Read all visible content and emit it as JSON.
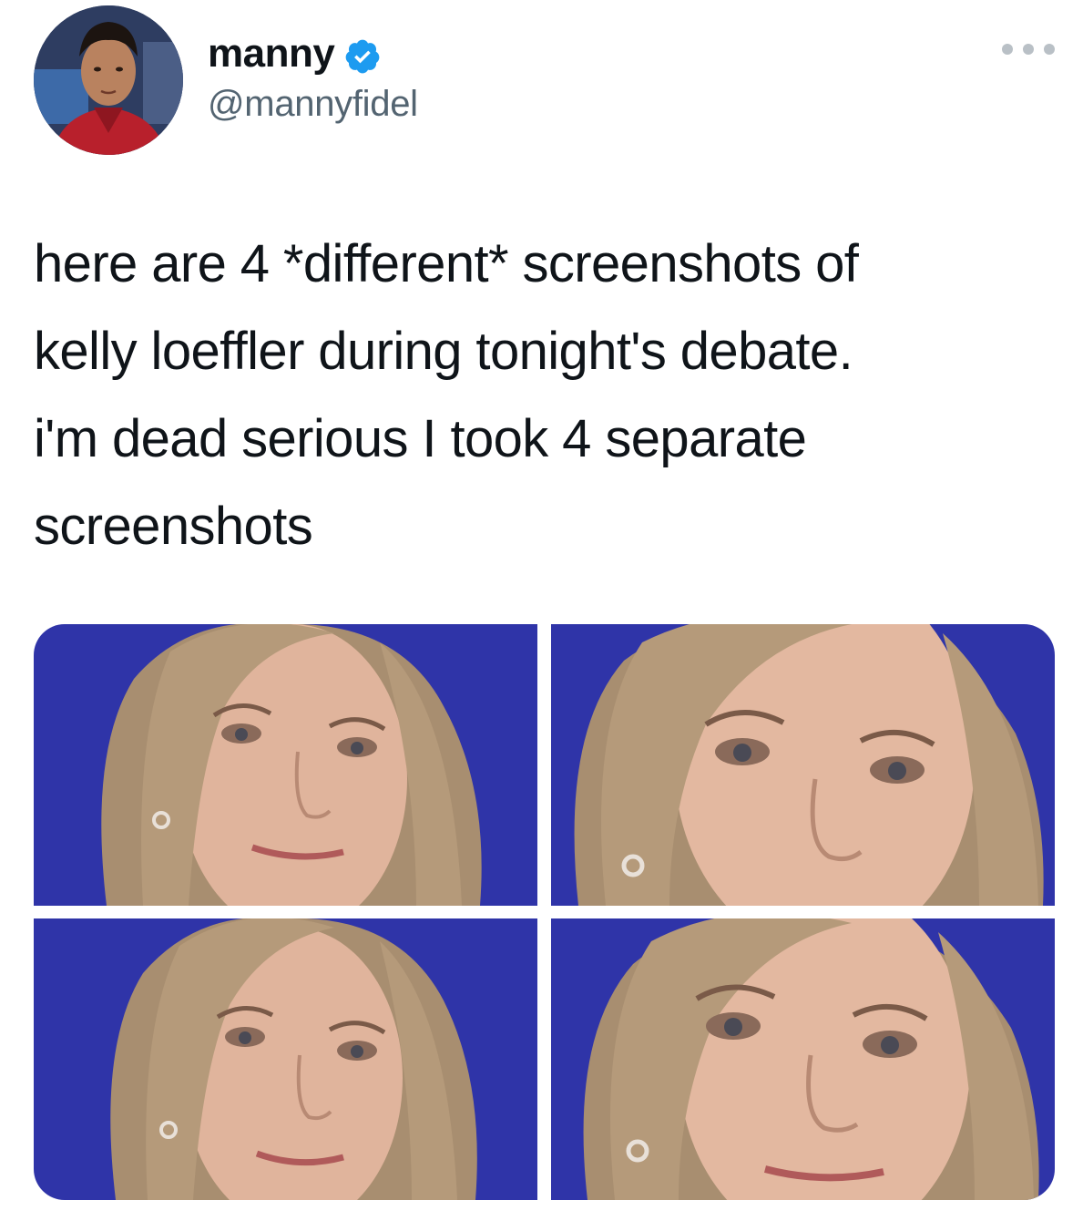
{
  "tweet": {
    "display_name": "manny",
    "handle": "@mannyfidel",
    "verified": true,
    "text": "here are 4 *different* screenshots of kelly loeffler during tonight's debate. i'm dead serious I took 4 separate screenshots",
    "text_lines": [
      "here are 4 *different* screenshots of",
      "kelly loeffler during tonight's debate.",
      "i'm dead serious I took 4 separate",
      "screenshots"
    ]
  },
  "icons": {
    "verified": "verified-badge-icon",
    "more": "more-options-icon"
  },
  "colors": {
    "verified_blue": "#1d9bf0",
    "handle_gray": "#536471",
    "background_blue": "#2f34a8",
    "text": "#0f1419"
  },
  "media": [
    {
      "position": "top-left"
    },
    {
      "position": "top-right"
    },
    {
      "position": "bottom-left"
    },
    {
      "position": "bottom-right"
    }
  ]
}
